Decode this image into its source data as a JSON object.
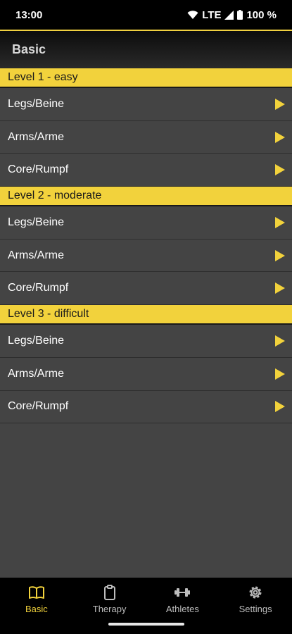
{
  "status_bar": {
    "time": "13:00",
    "network": "LTE",
    "battery": "100 %"
  },
  "app_bar": {
    "title": "Basic"
  },
  "sections": [
    {
      "title": "Level 1 - easy",
      "items": [
        "Legs/Beine",
        "Arms/Arme",
        "Core/Rumpf"
      ]
    },
    {
      "title": "Level 2 - moderate",
      "items": [
        "Legs/Beine",
        "Arms/Arme",
        "Core/Rumpf"
      ]
    },
    {
      "title": "Level 3 - difficult",
      "items": [
        "Legs/Beine",
        "Arms/Arme",
        "Core/Rumpf"
      ]
    }
  ],
  "bottom_nav": [
    {
      "label": "Basic",
      "icon": "book-icon",
      "active": true
    },
    {
      "label": "Therapy",
      "icon": "clipboard-icon",
      "active": false
    },
    {
      "label": "Athletes",
      "icon": "dumbbell-icon",
      "active": false
    },
    {
      "label": "Settings",
      "icon": "gear-icon",
      "active": false
    }
  ],
  "colors": {
    "accent": "#f2d23c",
    "background": "#444444",
    "bar": "#000000"
  }
}
